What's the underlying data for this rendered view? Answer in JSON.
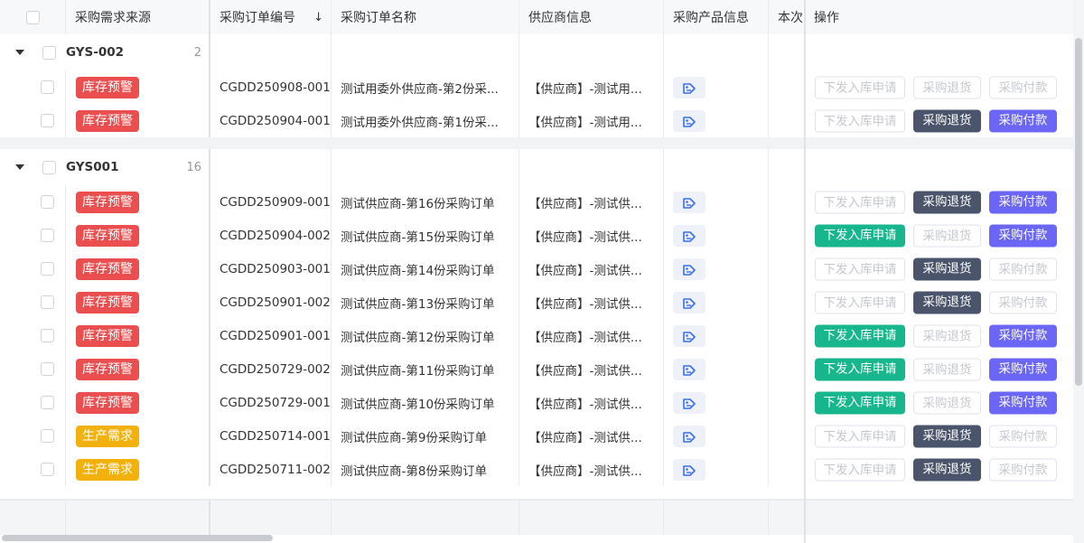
{
  "header": {
    "col_source": "采购需求来源",
    "col_order_no": "采购订单编号",
    "col_order_name": "采购订单名称",
    "col_supplier": "供应商信息",
    "col_product": "采购产品信息",
    "col_this": "本次",
    "col_actions": "操作",
    "sort_icon": "↓"
  },
  "actions": {
    "inbound": "下发入库申请",
    "return": "采购退货",
    "pay": "采购付款"
  },
  "colors": {
    "warn": "#ea4e4e",
    "prod": "#f2b10c",
    "green": "#17b68c",
    "slate": "#4a556c",
    "purple": "#6b66f5"
  },
  "groups": [
    {
      "name": "GYS-002",
      "count": "2",
      "rows": [
        {
          "tag": "库存预警",
          "tag_type": "warn",
          "order_no": "CGDD250908-001",
          "order_name": "测试用委外供应商-第2份采...",
          "supplier": "【供应商】-测试用...",
          "inbound": "disabled",
          "return": "disabled",
          "pay": "disabled"
        },
        {
          "tag": "库存预警",
          "tag_type": "warn",
          "order_no": "CGDD250904-001",
          "order_name": "测试用委外供应商-第1份采...",
          "supplier": "【供应商】-测试用...",
          "inbound": "disabled",
          "return": "active",
          "pay": "active"
        }
      ]
    },
    {
      "name": "GYS001",
      "count": "16",
      "rows": [
        {
          "tag": "库存预警",
          "tag_type": "warn",
          "order_no": "CGDD250909-001",
          "order_name": "测试供应商-第16份采购订单",
          "supplier": "【供应商】-测试供...",
          "inbound": "disabled",
          "return": "active",
          "pay": "active"
        },
        {
          "tag": "库存预警",
          "tag_type": "warn",
          "order_no": "CGDD250904-002",
          "order_name": "测试供应商-第15份采购订单",
          "supplier": "【供应商】-测试供...",
          "inbound": "active",
          "return": "disabled",
          "pay": "active"
        },
        {
          "tag": "库存预警",
          "tag_type": "warn",
          "order_no": "CGDD250903-001",
          "order_name": "测试供应商-第14份采购订单",
          "supplier": "【供应商】-测试供...",
          "inbound": "disabled",
          "return": "active",
          "pay": "disabled"
        },
        {
          "tag": "库存预警",
          "tag_type": "warn",
          "order_no": "CGDD250901-002",
          "order_name": "测试供应商-第13份采购订单",
          "supplier": "【供应商】-测试供...",
          "inbound": "disabled",
          "return": "active",
          "pay": "disabled"
        },
        {
          "tag": "库存预警",
          "tag_type": "warn",
          "order_no": "CGDD250901-001",
          "order_name": "测试供应商-第12份采购订单",
          "supplier": "【供应商】-测试供...",
          "inbound": "active",
          "return": "disabled",
          "pay": "active"
        },
        {
          "tag": "库存预警",
          "tag_type": "warn",
          "order_no": "CGDD250729-002",
          "order_name": "测试供应商-第11份采购订单",
          "supplier": "【供应商】-测试供...",
          "inbound": "active",
          "return": "disabled",
          "pay": "active"
        },
        {
          "tag": "库存预警",
          "tag_type": "warn",
          "order_no": "CGDD250729-001",
          "order_name": "测试供应商-第10份采购订单",
          "supplier": "【供应商】-测试供...",
          "inbound": "active",
          "return": "disabled",
          "pay": "active"
        },
        {
          "tag": "生产需求",
          "tag_type": "prod",
          "order_no": "CGDD250714-001",
          "order_name": "测试供应商-第9份采购订单",
          "supplier": "【供应商】-测试供...",
          "inbound": "disabled",
          "return": "active",
          "pay": "disabled"
        },
        {
          "tag": "生产需求",
          "tag_type": "prod",
          "order_no": "CGDD250711-002",
          "order_name": "测试供应商-第8份采购订单",
          "supplier": "【供应商】-测试供...",
          "inbound": "disabled",
          "return": "active",
          "pay": "disabled"
        }
      ]
    }
  ]
}
